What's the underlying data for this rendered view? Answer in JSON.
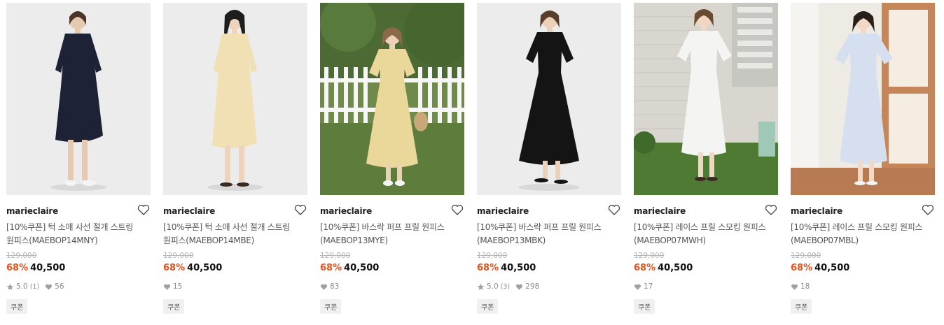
{
  "products": [
    {
      "brand": "marieclaire",
      "title_line1": "[10%쿠폰] 턱 소매 사선 절개 스트링",
      "title_line2": "원피스(MAEBOP14MNY)",
      "original_price": "129,000",
      "discount": "68%",
      "price": "40,500",
      "rating": "5.0",
      "reviews": "(1)",
      "likes": "56",
      "badge": "쿠폰",
      "dress_color": "#1e2236",
      "bg_color": "#ececec",
      "scene": "studio"
    },
    {
      "brand": "marieclaire",
      "title_line1": "[10%쿠폰] 턱 소매 사선 절개 스트링",
      "title_line2": "원피스(MAEBOP14MBE)",
      "original_price": "129,000",
      "discount": "68%",
      "price": "40,500",
      "likes": "15",
      "badge": "쿠폰",
      "dress_color": "#f1e0b4",
      "bg_color": "#ececec",
      "scene": "studio"
    },
    {
      "brand": "marieclaire",
      "title_line1": "[10%쿠폰] 바스락 퍼프 프릴 원피스",
      "title_line2": "(MAEBOP13MYE)",
      "original_price": "129,000",
      "discount": "68%",
      "price": "40,500",
      "likes": "83",
      "badge": "쿠폰",
      "dress_color": "#ead79a",
      "bg_color": "#6f8a4a",
      "scene": "garden"
    },
    {
      "brand": "marieclaire",
      "title_line1": "[10%쿠폰] 바스락 퍼프 프릴 원피스",
      "title_line2": "(MAEBOP13MBK)",
      "original_price": "129,000",
      "discount": "68%",
      "price": "40,500",
      "rating": "5.0",
      "reviews": "(3)",
      "likes": "298",
      "badge": "쿠폰",
      "dress_color": "#141414",
      "bg_color": "#ececec",
      "scene": "studio"
    },
    {
      "brand": "marieclaire",
      "title_line1": "[10%쿠폰] 레이스 프릴 스모킹 원피스",
      "title_line2": "(MAEBOP07MWH)",
      "original_price": "129,000",
      "discount": "68%",
      "price": "40,500",
      "likes": "17",
      "badge": "쿠폰",
      "dress_color": "#f4f4f2",
      "bg_color": "#d9d6cf",
      "scene": "brickwall"
    },
    {
      "brand": "marieclaire",
      "title_line1": "[10%쿠폰] 레이스 프릴 스모킹 원피스",
      "title_line2": "(MAEBOP07MBL)",
      "original_price": "129,000",
      "discount": "68%",
      "price": "40,500",
      "likes": "18",
      "badge": "쿠폰",
      "dress_color": "#d6dff0",
      "bg_color": "#eeeae4",
      "scene": "door"
    }
  ],
  "colors": {
    "discount": "#e8541e",
    "price": "#111111",
    "muted": "#8c8c8c"
  }
}
